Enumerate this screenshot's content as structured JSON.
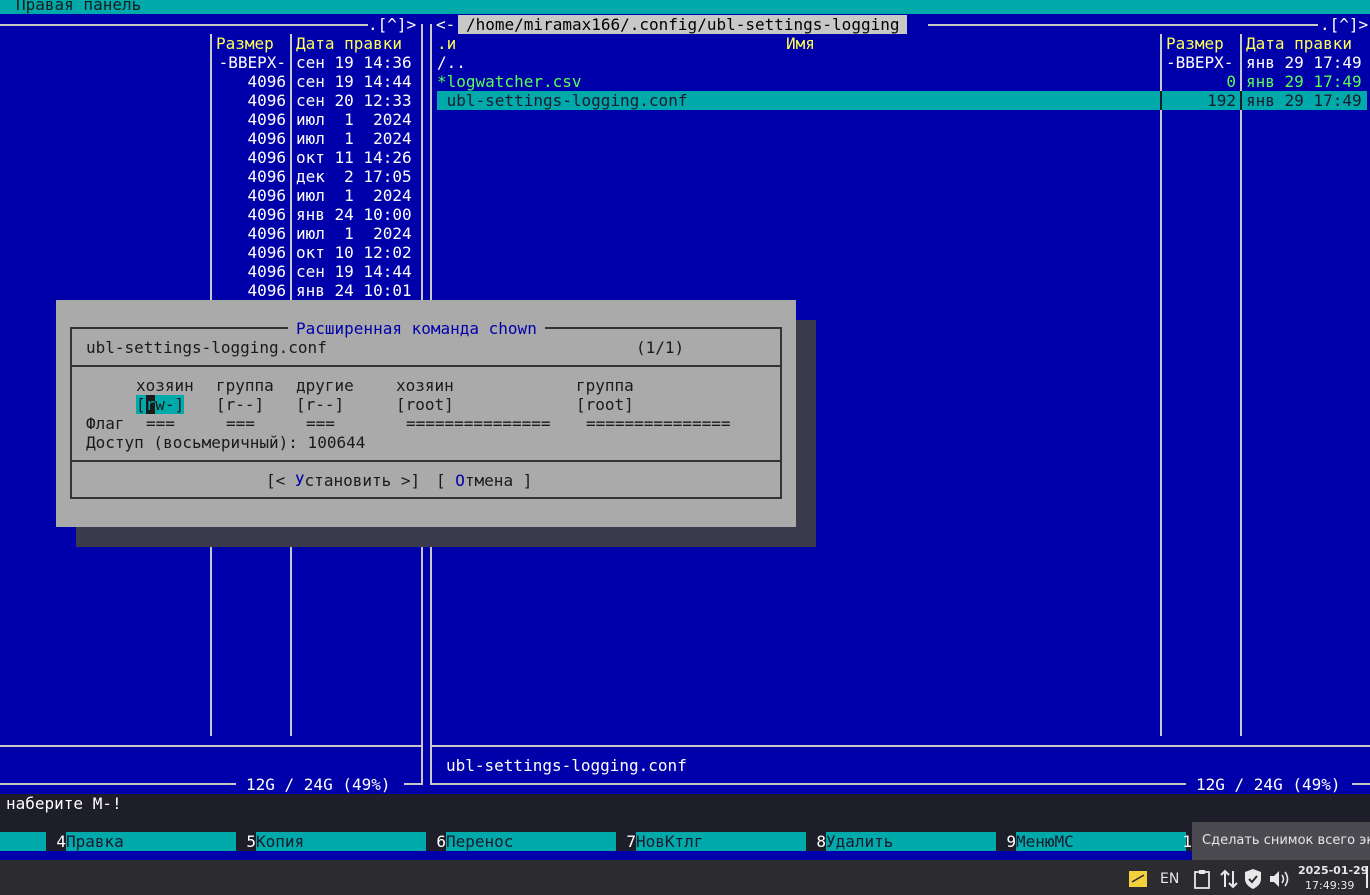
{
  "menubar": {
    "title": "Правая панель"
  },
  "left_panel": {
    "corner": ".[^]>",
    "col_size": "Размер",
    "col_date": "Дата правки",
    "rows": [
      {
        "size": "-ВВЕРХ-",
        "date": "сен 19 14:36"
      },
      {
        "size": "4096",
        "date": "сен 19 14:44"
      },
      {
        "size": "4096",
        "date": "сен 20 12:33"
      },
      {
        "size": "4096",
        "date": "июл  1  2024"
      },
      {
        "size": "4096",
        "date": "июл  1  2024"
      },
      {
        "size": "4096",
        "date": "окт 11 14:26"
      },
      {
        "size": "4096",
        "date": "дек  2 17:05"
      },
      {
        "size": "4096",
        "date": "июл  1  2024"
      },
      {
        "size": "4096",
        "date": "янв 24 10:00"
      },
      {
        "size": "4096",
        "date": "июл  1  2024"
      },
      {
        "size": "4096",
        "date": "окт 10 12:02"
      },
      {
        "size": "4096",
        "date": "сен 19 14:44"
      },
      {
        "size": "4096",
        "date": "янв 24 10:01"
      }
    ],
    "disk": "12G / 24G (49%)"
  },
  "right_panel": {
    "left_arrow": "<-",
    "path": "/home/miramax166/.config/ubl-settings-logging",
    "corner": ".[^]>",
    "col_sort": ".и",
    "col_name": "Имя",
    "col_size": "Размер",
    "col_date": "Дата правки",
    "rows": [
      {
        "name": "/..",
        "size": "-ВВЕРХ-",
        "date": "янв 29 17:49"
      },
      {
        "name": "*logwatcher.csv",
        "size": "0",
        "date": "янв 29 17:49"
      },
      {
        "name": " ubl-settings-logging.conf",
        "size": "192",
        "date": "янв 29 17:49"
      }
    ],
    "status_file": "ubl-settings-logging.conf",
    "disk": "12G / 24G (49%)"
  },
  "dialog": {
    "title": "Расширенная команда chown",
    "filename": "ubl-settings-logging.conf",
    "counter": "(1/1)",
    "h_owner": "хозяин",
    "h_group": "группа",
    "h_other": "другие",
    "h_owner2": "хозяин",
    "h_group2": "группа",
    "perm_owner_open": "[",
    "perm_owner_cursor": "r",
    "perm_owner_rest": "w-]",
    "perm_group": "[r--]",
    "perm_other": "[r--]",
    "owner_value": "[root]",
    "group_value": "[root]",
    "flag_label": "Флаг",
    "flag1": "===",
    "flag2": "===",
    "flag3": "===",
    "flag_owner": "===============",
    "flag_group": "===============",
    "access_label": "Доступ (восьмеричный): 100644",
    "btn_set_pre": "[< ",
    "btn_set_hot": "У",
    "btn_set_rest": "становить >]",
    "btn_cancel_pre": "[ ",
    "btn_cancel_hot": "О",
    "btn_cancel_rest": "тмена ]"
  },
  "cmdline": {
    "text": "наберите M-!"
  },
  "fkeys": [
    {
      "num": "4",
      "label": "Правка"
    },
    {
      "num": "5",
      "label": "Копия"
    },
    {
      "num": "6",
      "label": "Перенос"
    },
    {
      "num": "7",
      "label": "НовКтлг"
    },
    {
      "num": "8",
      "label": "Удалить"
    },
    {
      "num": "9",
      "label": "МенюMC"
    },
    {
      "num": "1",
      "label": ""
    }
  ],
  "tooltip": {
    "text": "Сделать снимок всего экрана"
  },
  "tray": {
    "lang": "EN",
    "date": "2025-01-29",
    "time": "17:49:39"
  }
}
